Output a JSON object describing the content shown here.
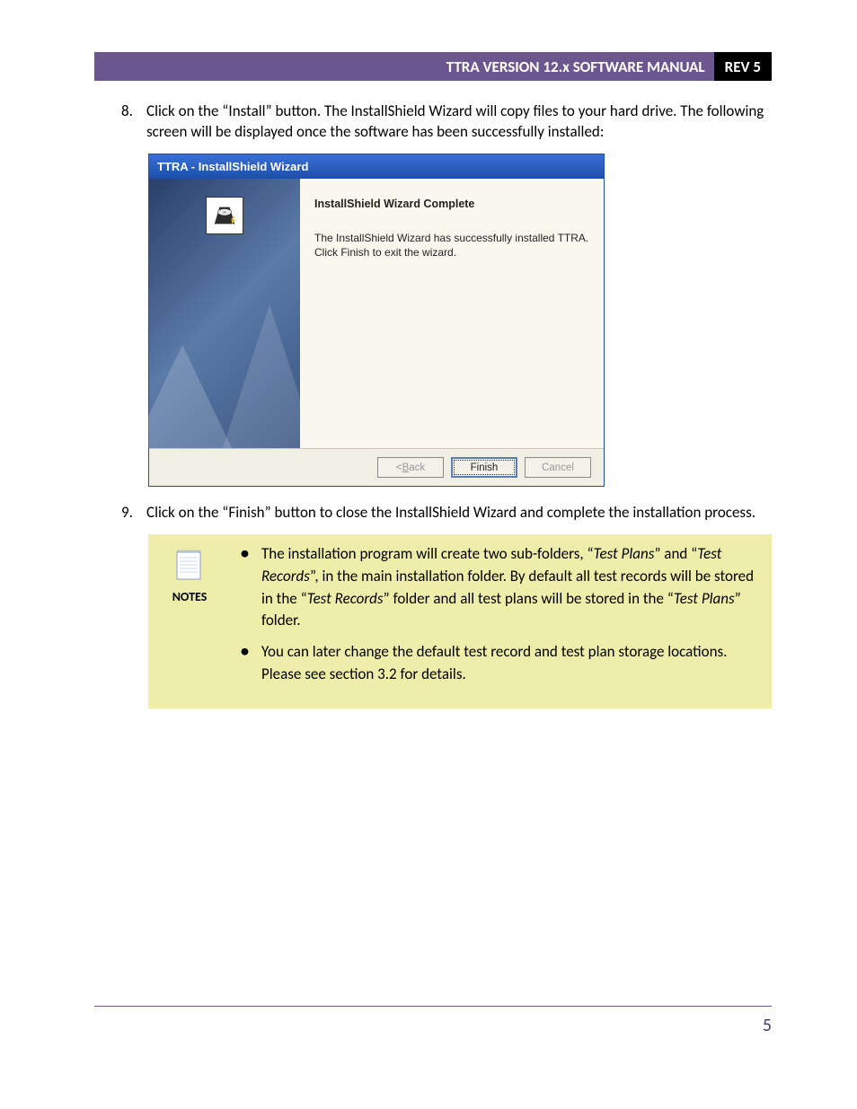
{
  "header": {
    "title": "TTRA VERSION 12.x SOFTWARE MANUAL",
    "rev": "REV 5"
  },
  "step8": {
    "num": "8.",
    "text": "Click on the “Install” button. The InstallShield Wizard will copy files to your hard drive. The following screen will be displayed once the software has been successfully installed:"
  },
  "wizard": {
    "title": "TTRA - InstallShield Wizard",
    "heading": "InstallShield Wizard Complete",
    "body": "The InstallShield Wizard has successfully installed TTRA. Click Finish to exit the wizard.",
    "buttons": {
      "back_prefix": "< ",
      "back_key": "B",
      "back_rest": "ack",
      "finish": "Finish",
      "cancel": "Cancel"
    }
  },
  "step9": {
    "num": "9.",
    "text": "Click on the “Finish” button to close the InstallShield Wizard and complete the installation process."
  },
  "notes": {
    "label": "NOTES",
    "items": {
      "0": {
        "p1": "The installation program will create two sub-folders, “",
        "i1": "Test Plans",
        "p2": "” and “",
        "i2": "Test Records",
        "p3": "”, in the main installation folder. By default all test records will be stored in the “",
        "i3": "Test Records",
        "p4": "” folder and all test plans will be stored in the “",
        "i4": "Test Plans",
        "p5": "” folder."
      },
      "1": "You can later change the default test record and test plan storage locations. Please see section 3.2 for details."
    }
  },
  "page_number": "5"
}
